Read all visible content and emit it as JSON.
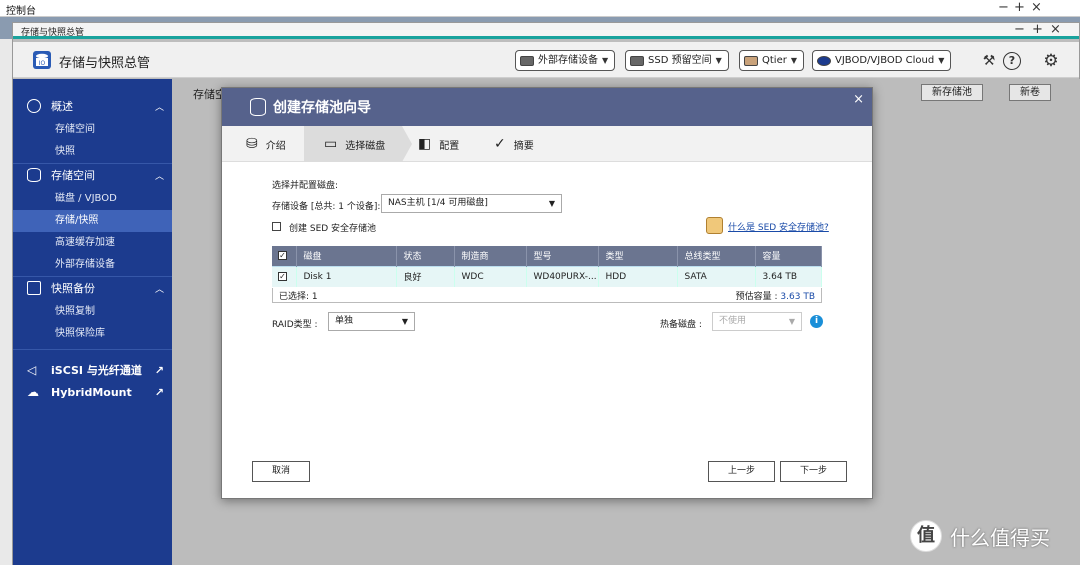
{
  "outer": {
    "title": "控制台",
    "min": "−",
    "max": "+",
    "close": "×"
  },
  "app": {
    "window_title": "存储与快照总管",
    "name": "存储与快照总管",
    "min": "−",
    "max": "+",
    "close": "×",
    "header_buttons": [
      {
        "label": "外部存储设备",
        "icon": "external-storage-icon"
      },
      {
        "label": "SSD 预留空间",
        "icon": "ssd-icon"
      },
      {
        "label": "Qtier",
        "icon": "qtier-icon"
      },
      {
        "label": "VJBOD/VJBOD Cloud",
        "icon": "vjbod-icon"
      }
    ]
  },
  "sidebar": {
    "groups": [
      {
        "label": "概述",
        "items": [
          "存储空间",
          "快照"
        ]
      },
      {
        "label": "存储空间",
        "items": [
          "磁盘 / VJBOD",
          "存储/快照",
          "高速缓存加速",
          "外部存储设备"
        ]
      },
      {
        "label": "快照备份",
        "items": [
          "快照复制",
          "快照保险库"
        ]
      }
    ],
    "active_item": "存储/快照",
    "links": [
      {
        "label": "iSCSI 与光纤通道"
      },
      {
        "label": "HybridMount"
      }
    ]
  },
  "content": {
    "title": "存储空",
    "new_pool": "新存储池",
    "new_volume": "新卷"
  },
  "wizard": {
    "title": "创建存储池向导",
    "close": "×",
    "steps": [
      "介绍",
      "选择磁盘",
      "配置",
      "摘要"
    ],
    "active_step": 1,
    "section_label": "选择并配置磁盘:",
    "device_label": "存储设备 [总共: 1 个设备]:",
    "device_value": "NAS主机 [1/4 可用磁盘]",
    "sed_label": "创建 SED 安全存储池",
    "sed_help_link": "什么是 SED 安全存储池?",
    "table": {
      "headers": [
        "磁盘",
        "状态",
        "制造商",
        "型号",
        "类型",
        "总线类型",
        "容量"
      ],
      "rows": [
        {
          "checked": true,
          "cells": [
            "Disk 1",
            "良好",
            "WDC",
            "WD40PURX-...",
            "HDD",
            "SATA",
            "3.64 TB"
          ]
        }
      ],
      "selected_text": "已选择: 1",
      "capacity_label": "预估容量 :",
      "capacity_value": "3.63 TB"
    },
    "raid_label": "RAID类型 :",
    "raid_value": "单独",
    "spare_label": "热备磁盘 :",
    "spare_value": "不使用",
    "cancel": "取消",
    "prev": "上一步",
    "next": "下一步"
  },
  "watermark": {
    "logo": "值",
    "text": "什么值得买"
  }
}
